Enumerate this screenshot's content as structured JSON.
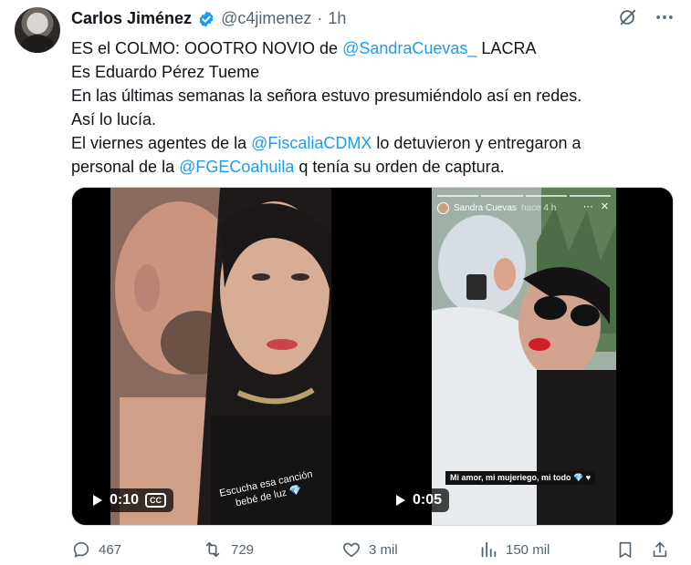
{
  "author": {
    "name": "Carlos Jiménez",
    "handle": "@c4jimenez",
    "separator": "·",
    "time": "1h"
  },
  "tweet": {
    "line1_a": "ES el COLMO: OOOTRO NOVIO de ",
    "line1_mention": "@SandraCuevas_",
    "line1_b": " LACRA",
    "line2": "Es Eduardo Pérez Tueme",
    "line3": "En las últimas semanas la señora estuvo presumiéndolo así en redes.",
    "line4": "Así lo lucía.",
    "line5_a": "El viernes agentes de la ",
    "line5_mention": "@FiscaliaCDMX",
    "line5_b": " lo detuvieron  y entregaron a",
    "line6_a": "personal de la ",
    "line6_mention": "@FGECoahuila",
    "line6_b": " q tenía su orden de captura."
  },
  "videos": [
    {
      "duration": "0:10",
      "cc_label": "CC",
      "caption_line1": "Escucha esa canción",
      "caption_line2": "bebé de luz 💎"
    },
    {
      "duration": "0:05",
      "story_user": "Sandra Cuevas",
      "story_ago": "hace 4 h",
      "caption": "Mi amor, mi mujeriego, mi todo 💎 ♥"
    }
  ],
  "stats": {
    "replies": "467",
    "reposts": "729",
    "likes": "3 mil",
    "views": "150 mil"
  },
  "colors": {
    "link": "#1d9bf0",
    "muted": "#536471",
    "verified": "#1d9bf0"
  }
}
